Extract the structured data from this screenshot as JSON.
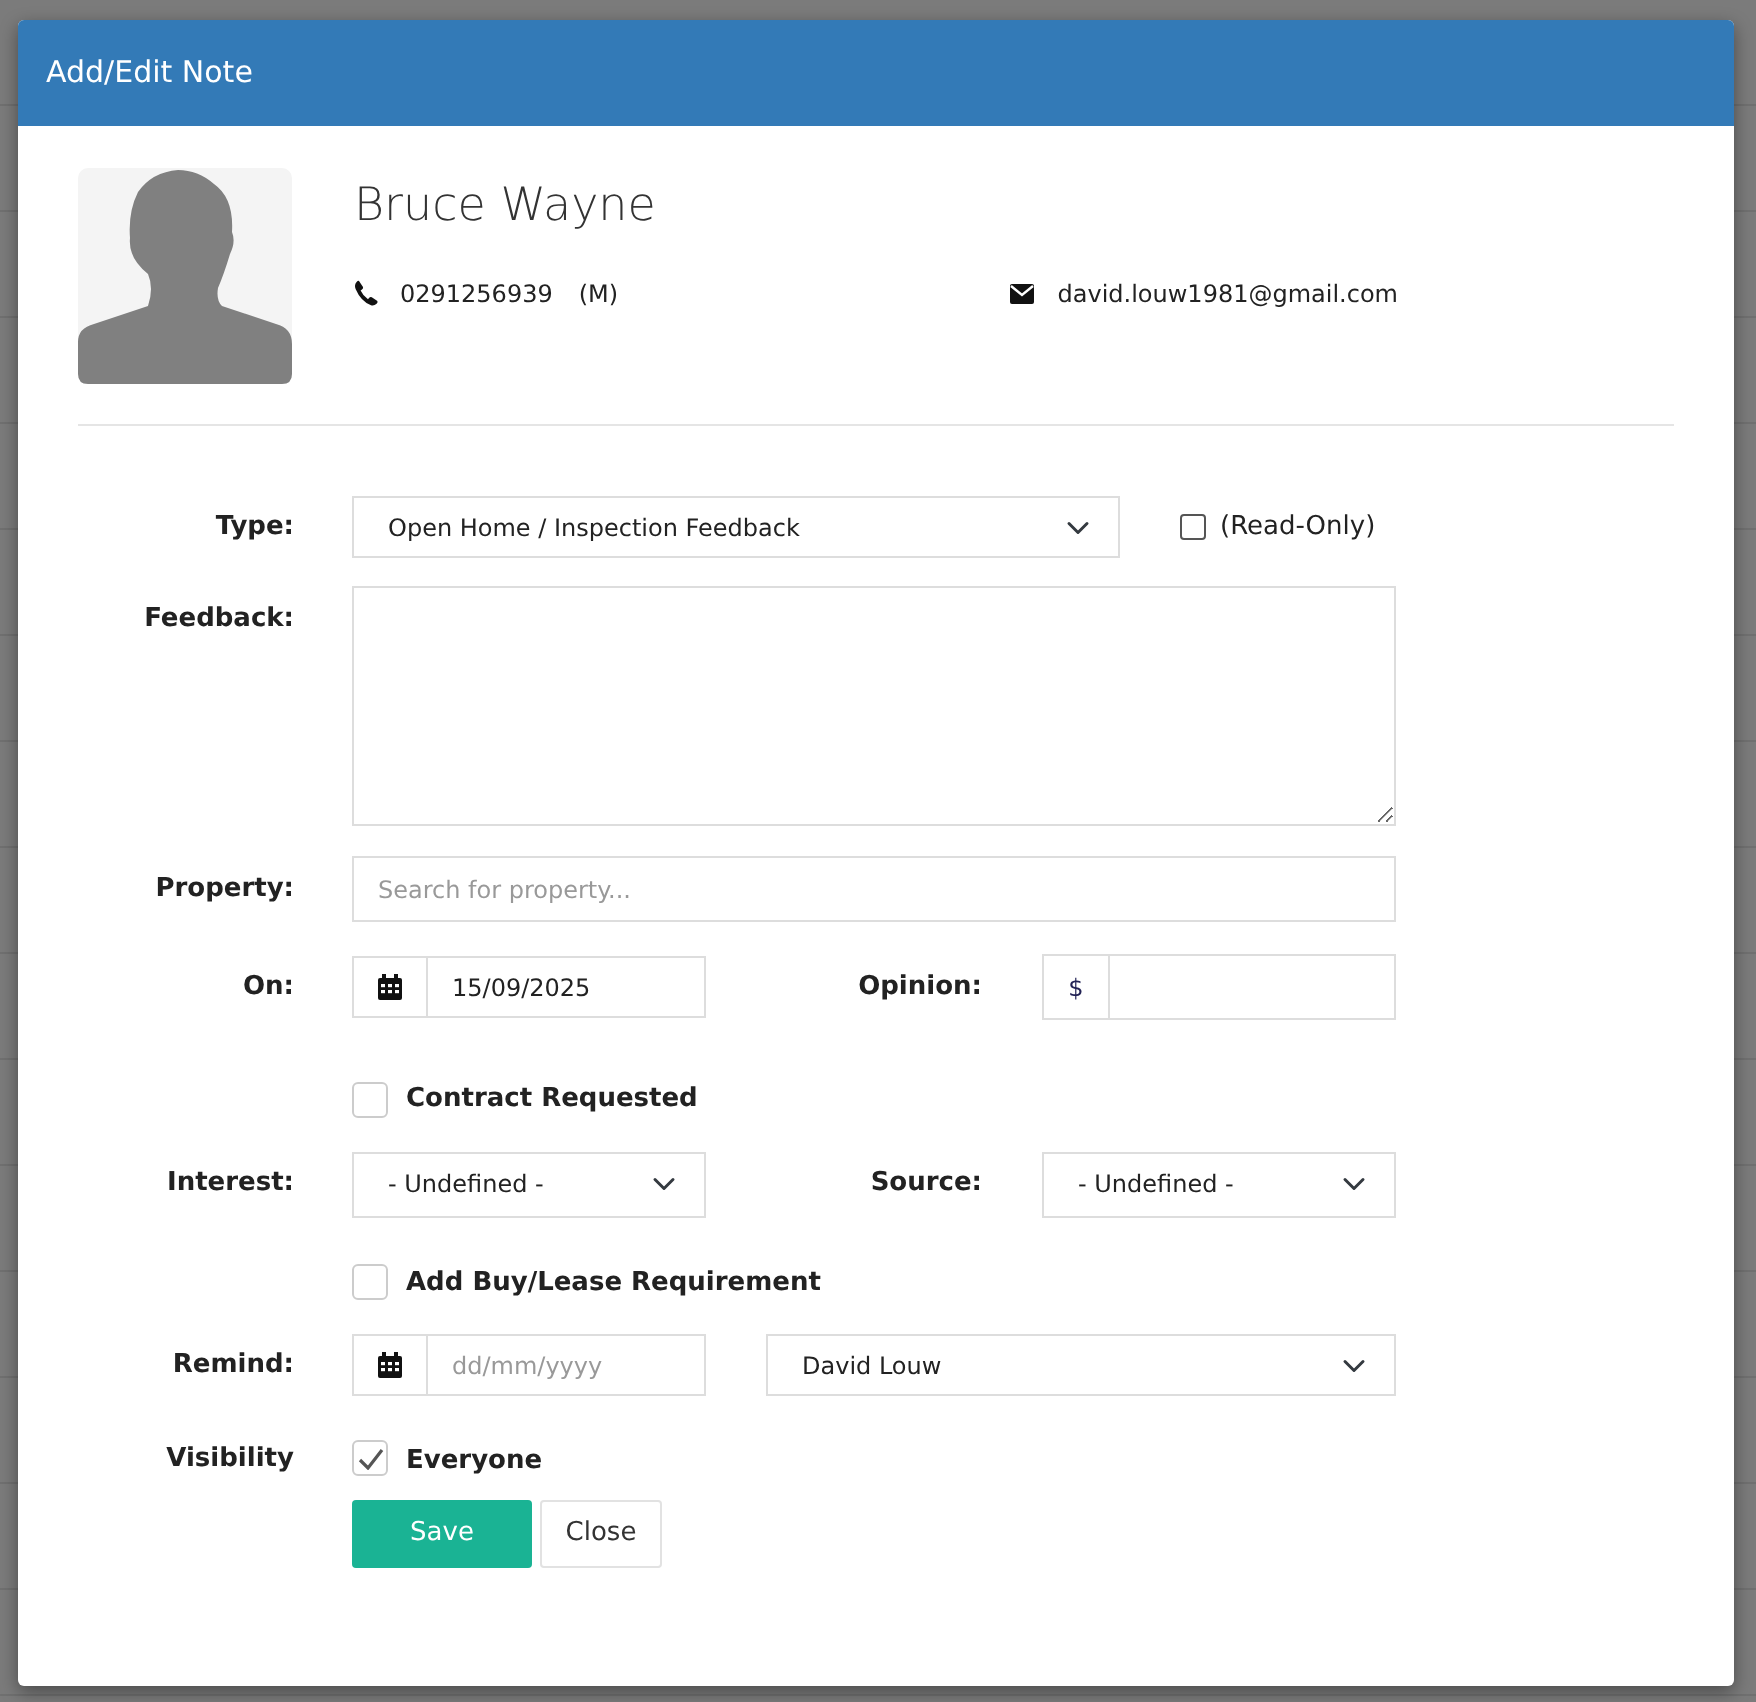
{
  "modal": {
    "title": "Add/Edit Note"
  },
  "contact": {
    "name": "Bruce Wayne",
    "phone": "0291256939",
    "phone_type": "(M)",
    "email": "david.louw1981@gmail.com"
  },
  "form": {
    "type": {
      "label": "Type:",
      "value": "Open Home / Inspection Feedback"
    },
    "read_only": {
      "label": "(Read-Only)",
      "checked": false
    },
    "feedback": {
      "label": "Feedback:"
    },
    "property": {
      "label": "Property:",
      "placeholder": "Search for property..."
    },
    "on": {
      "label": "On:",
      "value": "15/09/2025"
    },
    "opinion": {
      "label": "Opinion:",
      "prefix": "$"
    },
    "contract_requested": {
      "label": "Contract Requested",
      "checked": false
    },
    "interest": {
      "label": "Interest:",
      "value": "- Undefined -"
    },
    "source": {
      "label": "Source:",
      "value": "- Undefined -"
    },
    "buy_lease": {
      "label": "Add Buy/Lease Requirement",
      "checked": false
    },
    "remind": {
      "label": "Remind:",
      "placeholder": "dd/mm/yyyy",
      "assignee": "David Louw"
    },
    "visibility": {
      "label": "Visibility",
      "option": "Everyone",
      "checked": true
    }
  },
  "buttons": [
    {
      "label": "Save",
      "kind": "primary"
    },
    {
      "label": "Close",
      "kind": "secondary"
    }
  ]
}
